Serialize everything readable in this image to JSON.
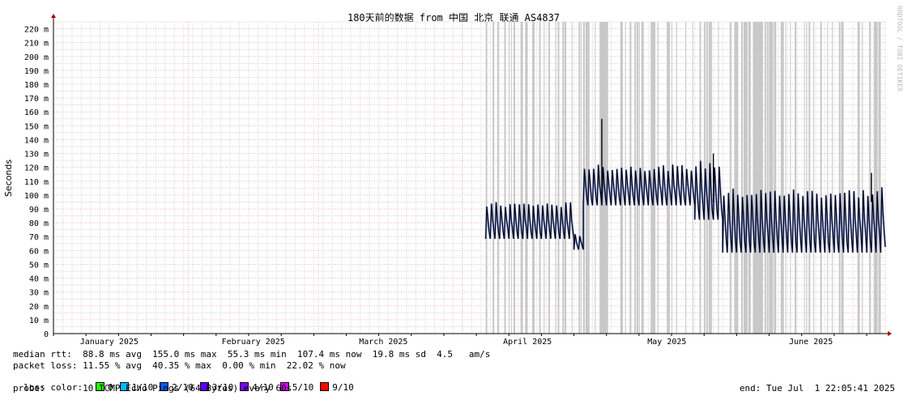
{
  "chart_data": {
    "type": "line",
    "title": "180天前的数据 from 中国 北京 联通 AS4837",
    "ylabel": "Seconds",
    "watermark": "RRDTOOL / TOBI OETIKER",
    "ylim": [
      0,
      225
    ],
    "y_ticks": [
      {
        "value": 0,
        "label": "0"
      },
      {
        "value": 10,
        "label": "10 m"
      },
      {
        "value": 20,
        "label": "20 m"
      },
      {
        "value": 30,
        "label": "30 m"
      },
      {
        "value": 40,
        "label": "40 m"
      },
      {
        "value": 50,
        "label": "50 m"
      },
      {
        "value": 60,
        "label": "60 m"
      },
      {
        "value": 70,
        "label": "70 m"
      },
      {
        "value": 80,
        "label": "80 m"
      },
      {
        "value": 90,
        "label": "90 m"
      },
      {
        "value": 100,
        "label": "100 m"
      },
      {
        "value": 110,
        "label": "110 m"
      },
      {
        "value": 120,
        "label": "120 m"
      },
      {
        "value": 130,
        "label": "130 m"
      },
      {
        "value": 140,
        "label": "140 m"
      },
      {
        "value": 150,
        "label": "150 m"
      },
      {
        "value": 160,
        "label": "160 m"
      },
      {
        "value": 170,
        "label": "170 m"
      },
      {
        "value": 180,
        "label": "180 m"
      },
      {
        "value": 190,
        "label": "190 m"
      },
      {
        "value": 200,
        "label": "200 m"
      },
      {
        "value": 210,
        "label": "210 m"
      },
      {
        "value": 220,
        "label": "220 m"
      }
    ],
    "xlim": [
      "2025-01-03",
      "2025-07-01"
    ],
    "x_month_starts": [
      "2025-01-01",
      "2025-02-01",
      "2025-03-01",
      "2025-04-01",
      "2025-05-01",
      "2025-06-01",
      "2025-07-01"
    ],
    "x_labels": [
      {
        "date": "2025-01-15",
        "label": "January 2025"
      },
      {
        "date": "2025-02-15",
        "label": "February 2025"
      },
      {
        "date": "2025-03-15",
        "label": "March 2025"
      },
      {
        "date": "2025-04-15",
        "label": "April 2025"
      },
      {
        "date": "2025-05-15",
        "label": "May 2025"
      },
      {
        "date": "2025-06-15",
        "label": "June 2025"
      }
    ],
    "series": [
      {
        "color": "#000000",
        "segments": [
          {
            "start": "2025-04-06",
            "end": "2025-04-25",
            "low": 67,
            "high": 95
          },
          {
            "start": "2025-04-25",
            "end": "2025-04-27",
            "low": 60,
            "high": 72
          },
          {
            "start": "2025-04-27",
            "end": "2025-05-21",
            "low": 91,
            "high": 122
          },
          {
            "start": "2025-05-21",
            "end": "2025-05-27",
            "low": 80,
            "high": 125
          },
          {
            "start": "2025-05-27",
            "end": "2025-06-30",
            "low": 56,
            "high": 105
          },
          {
            "start": "2025-06-30",
            "end": "2025-07-01",
            "low": 60,
            "high": 110
          }
        ],
        "spikes": [
          {
            "date": "2025-05-01",
            "value": 155
          },
          {
            "date": "2025-05-25",
            "value": 130
          },
          {
            "date": "2025-06-28",
            "value": 116
          }
        ]
      }
    ],
    "loss_bars": {
      "color": "#c8c8c8",
      "start": "2025-04-06",
      "end": "2025-07-01",
      "top": 225
    }
  },
  "legend": {
    "median_rtt": "median rtt:  88.8 ms avg  155.0 ms max  55.3 ms min  107.4 ms now  19.8 ms sd  4.5   am/s",
    "packet_loss": "packet loss: 11.55 % avg  40.35 % max  0.00 % min  22.02 % now",
    "loss_color_label": "loss color:",
    "loss_colors": [
      {
        "label": "0",
        "color": "#26ff00"
      },
      {
        "label": "1/10",
        "color": "#00b8ff"
      },
      {
        "label": "2/10",
        "color": "#0059ff"
      },
      {
        "label": "3/10",
        "color": "#5e00ff"
      },
      {
        "label": "4/10",
        "color": "#7e00ff"
      },
      {
        "label": "5/10",
        "color": "#dd00ff"
      },
      {
        "label": "9/10",
        "color": "#ff0000"
      }
    ],
    "probe": "probe:       10 ICMP Echo Pings (64 Bytes) every 60s",
    "end": "end: Tue Jul  1 22:05:41 2025"
  }
}
